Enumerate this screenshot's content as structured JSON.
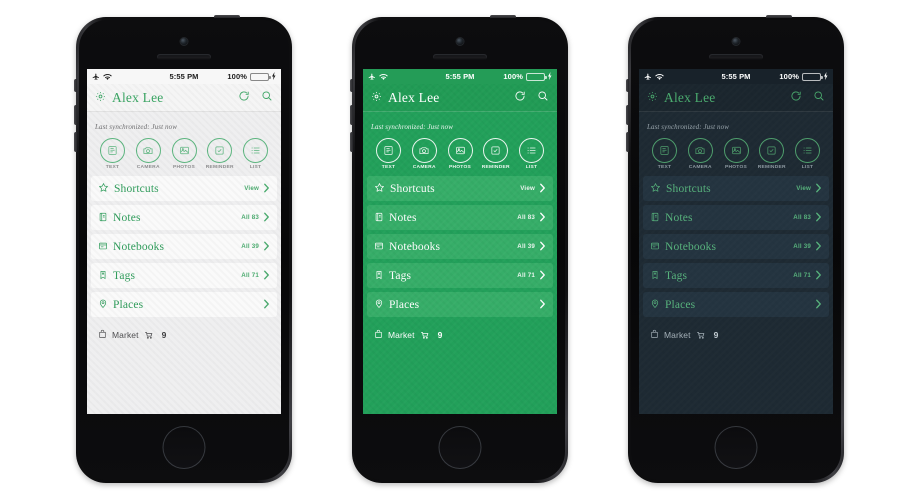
{
  "theme_colors": {
    "brand_green": "#22a05a",
    "light_green_text": "#2f9d5b",
    "dark_bg": "#1e2a33",
    "dark_row": "#243440",
    "light_bg": "#efeff0",
    "light_row": "#fafafa",
    "battery_green": "#4cd964"
  },
  "status_bar": {
    "airplane_icon": "airplane-icon",
    "wifi_icon": "wifi-icon",
    "time": "5:55 PM",
    "battery_percent": "100%",
    "battery_icon": "battery-full-icon",
    "charging_icon": "bolt-icon"
  },
  "header": {
    "gear_icon": "gear-icon",
    "user_name": "Alex Lee",
    "sync_icon": "sync-icon",
    "search_icon": "search-icon"
  },
  "sync": {
    "text": "Last synchronized: Just now"
  },
  "quick_actions": [
    {
      "label": "TEXT",
      "icon": "text-note-icon"
    },
    {
      "label": "CAMERA",
      "icon": "camera-icon"
    },
    {
      "label": "PHOTOS",
      "icon": "photos-icon"
    },
    {
      "label": "REMINDER",
      "icon": "reminder-clock-icon"
    },
    {
      "label": "LIST",
      "icon": "list-icon"
    }
  ],
  "rows": [
    {
      "label": "Shortcuts",
      "icon": "star-icon",
      "meta": "View",
      "chevron": "chevron-right-icon"
    },
    {
      "label": "Notes",
      "icon": "note-icon",
      "meta": "All 83",
      "chevron": "chevron-right-icon"
    },
    {
      "label": "Notebooks",
      "icon": "notebook-icon",
      "meta": "All 39",
      "chevron": "chevron-right-icon"
    },
    {
      "label": "Tags",
      "icon": "tag-icon",
      "meta": "All 71",
      "chevron": "chevron-right-icon"
    },
    {
      "label": "Places",
      "icon": "place-pin-icon",
      "meta": "",
      "chevron": "chevron-right-icon"
    }
  ],
  "footer": {
    "icon": "market-bag-icon",
    "label": "Market",
    "cart_icon": "cart-icon",
    "count": "9"
  },
  "phones": [
    {
      "theme": "light",
      "name": "phone-light-theme"
    },
    {
      "theme": "green",
      "name": "phone-green-theme"
    },
    {
      "theme": "dark",
      "name": "phone-dark-theme"
    }
  ]
}
